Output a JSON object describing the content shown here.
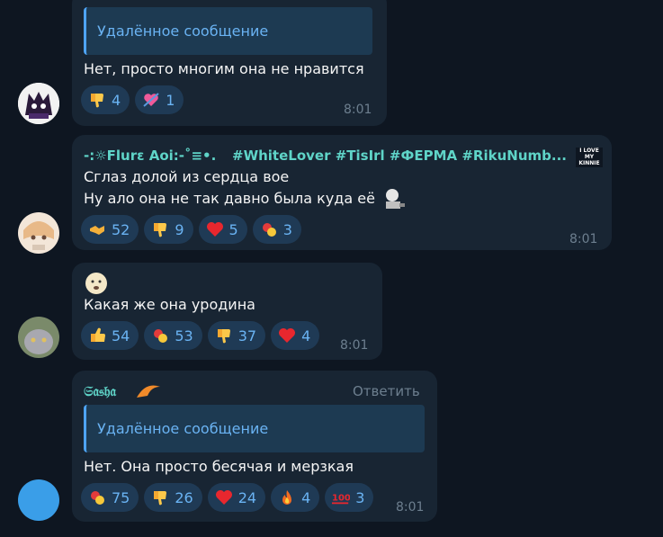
{
  "messages": [
    {
      "reply_preview": "Удалённое сообщение",
      "text": "Нет, просто многим она не нравится",
      "reactions": [
        {
          "emoji": "thumbs-down",
          "count": "4"
        },
        {
          "emoji": "heart-arrow",
          "count": "1"
        }
      ],
      "time": "8:01"
    },
    {
      "sender": "-:☼Flurɛ Aoi:-˚≡•.",
      "hashtags": "#WhiteLover #TisIrl #ФЕРМА #RikuNumb...",
      "badge_text": "I LOVE MY KINNIE",
      "lines": [
        "Сглаз долой из сердца вое",
        "Ну ало она не так давно была куда её"
      ],
      "reactions": [
        {
          "emoji": "handshake",
          "count": "52"
        },
        {
          "emoji": "thumbs-down",
          "count": "9"
        },
        {
          "emoji": "heart",
          "count": "5"
        },
        {
          "emoji": "pill",
          "count": "3"
        }
      ],
      "time": "8:01"
    },
    {
      "text": "Какая же она уродина",
      "reactions": [
        {
          "emoji": "thumbs-up",
          "count": "54"
        },
        {
          "emoji": "pill",
          "count": "53"
        },
        {
          "emoji": "thumbs-down",
          "count": "37"
        },
        {
          "emoji": "heart",
          "count": "4"
        }
      ],
      "time": "8:01"
    },
    {
      "sender": "𝔖𝔞𝔰𝔥𝔞",
      "reply_button": "Ответить",
      "reply_preview": "Удалённое сообщение",
      "text": "Нет. Она просто бесячая и мерзкая",
      "reactions": [
        {
          "emoji": "pill",
          "count": "75"
        },
        {
          "emoji": "thumbs-down",
          "count": "26"
        },
        {
          "emoji": "heart",
          "count": "24"
        },
        {
          "emoji": "fire",
          "count": "4"
        },
        {
          "emoji": "hundred",
          "count": "3"
        }
      ],
      "time": "8:01"
    }
  ],
  "colors": {
    "background": "#0e1621",
    "bubble": "#182533",
    "accent": "#6ab3f3",
    "name_teal": "#5fd4c8"
  }
}
